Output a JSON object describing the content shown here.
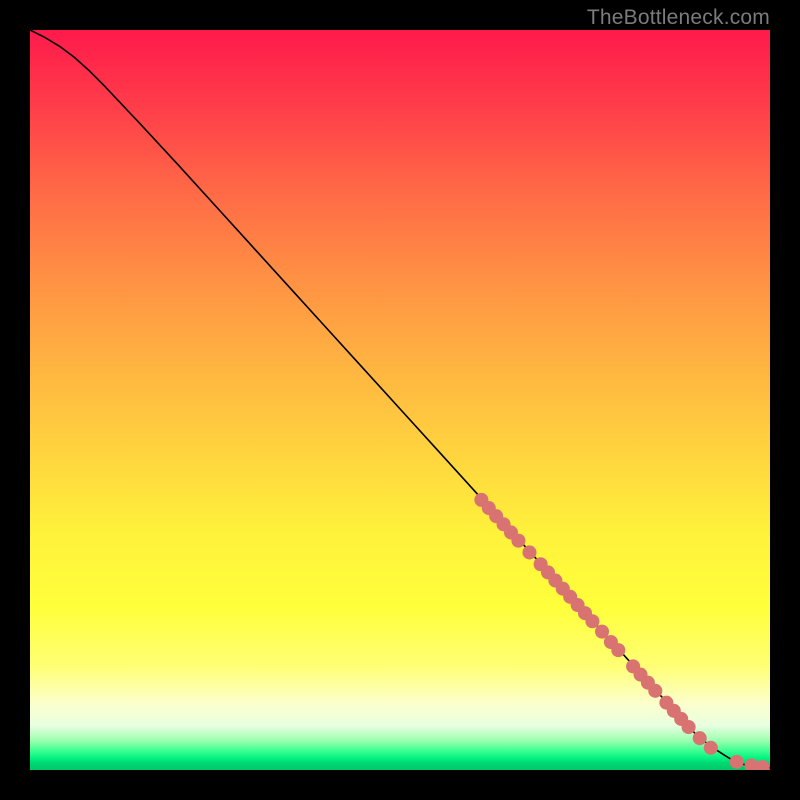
{
  "watermark": "TheBottleneck.com",
  "colors": {
    "dot": "#d97372",
    "curve": "#000000",
    "frame": "#000000"
  },
  "chart_data": {
    "type": "line",
    "title": "",
    "xlabel": "",
    "ylabel": "",
    "xlim": [
      0,
      100
    ],
    "ylim": [
      0,
      100
    ],
    "grid": false,
    "legend": false,
    "series": [
      {
        "name": "curve",
        "x": [
          0,
          2,
          4,
          6,
          8,
          10,
          15,
          20,
          25,
          30,
          35,
          40,
          45,
          50,
          55,
          60,
          65,
          70,
          75,
          80,
          85,
          90,
          92,
          94,
          95,
          96,
          97,
          98,
          99,
          100
        ],
        "y": [
          100,
          99,
          97.8,
          96.3,
          94.5,
          92.5,
          87.2,
          81.8,
          76.3,
          70.8,
          65.3,
          59.8,
          54.3,
          48.8,
          43.3,
          37.8,
          32.3,
          26.8,
          21.3,
          15.8,
          10.3,
          4.8,
          3.2,
          1.9,
          1.3,
          0.9,
          0.6,
          0.4,
          0.3,
          0.3
        ]
      }
    ],
    "markers": [
      {
        "x": 61.0,
        "y": 36.5
      },
      {
        "x": 62.0,
        "y": 35.4
      },
      {
        "x": 63.0,
        "y": 34.3
      },
      {
        "x": 64.0,
        "y": 33.2
      },
      {
        "x": 65.0,
        "y": 32.1
      },
      {
        "x": 66.0,
        "y": 31.0
      },
      {
        "x": 67.5,
        "y": 29.4
      },
      {
        "x": 69.0,
        "y": 27.8
      },
      {
        "x": 70.0,
        "y": 26.7
      },
      {
        "x": 71.0,
        "y": 25.6
      },
      {
        "x": 72.0,
        "y": 24.5
      },
      {
        "x": 73.0,
        "y": 23.4
      },
      {
        "x": 74.0,
        "y": 22.3
      },
      {
        "x": 75.0,
        "y": 21.2
      },
      {
        "x": 76.0,
        "y": 20.1
      },
      {
        "x": 77.3,
        "y": 18.7
      },
      {
        "x": 78.5,
        "y": 17.3
      },
      {
        "x": 79.5,
        "y": 16.2
      },
      {
        "x": 81.5,
        "y": 14.0
      },
      {
        "x": 82.5,
        "y": 12.9
      },
      {
        "x": 83.5,
        "y": 11.8
      },
      {
        "x": 84.5,
        "y": 10.7
      },
      {
        "x": 86.0,
        "y": 9.1
      },
      {
        "x": 87.0,
        "y": 8.0
      },
      {
        "x": 88.0,
        "y": 6.9
      },
      {
        "x": 89.0,
        "y": 5.8
      },
      {
        "x": 90.5,
        "y": 4.3
      },
      {
        "x": 92.0,
        "y": 3.0
      },
      {
        "x": 95.5,
        "y": 1.1
      },
      {
        "x": 97.5,
        "y": 0.6
      },
      {
        "x": 99.0,
        "y": 0.4
      }
    ],
    "marker_radius_x_units": 0.95
  }
}
